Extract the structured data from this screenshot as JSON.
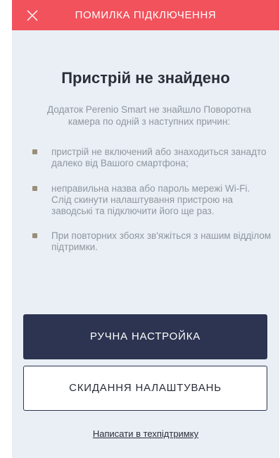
{
  "header": {
    "title": "ПОМИЛКА ПІДКЛЮЧЕННЯ",
    "close_icon": "close-icon"
  },
  "main": {
    "title": "Пристрій не знайдено",
    "description": "Додаток Perenio Smart не знайшло Поворотна камера по одній з наступних причин:",
    "reasons": [
      "пристрій не включений або знаходиться занадто далеко від Вашого смартфона;",
      "неправильна назва або пароль мережі Wi-Fi. Слід скинути налаштування пристрою на заводські та підключити його ще раз.",
      "При повторних збоях зв'яжіться з нашим відділом підтримки."
    ]
  },
  "actions": {
    "manual_setup_label": "РУЧНА НАСТРОЙКА",
    "reset_settings_label": "СКИДАННЯ НАЛАШТУВАНЬ",
    "support_link_label": "Написати в техпідтримку"
  },
  "colors": {
    "header": "#f2525c",
    "background": "#e9eff4",
    "primary_button": "#2d3451",
    "bullet": "#9a8e79"
  }
}
